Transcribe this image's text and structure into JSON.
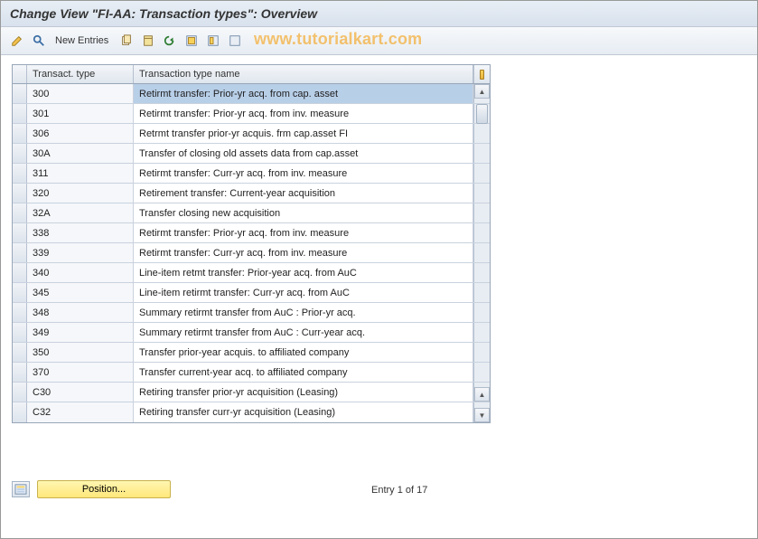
{
  "title": "Change View \"FI-AA: Transaction types\": Overview",
  "toolbar": {
    "new_entries": "New Entries"
  },
  "watermark": "www.tutorialkart.com",
  "table": {
    "headers": {
      "type": "Transact. type",
      "name": "Transaction type name"
    },
    "rows": [
      {
        "type": "300",
        "name": "Retirmt transfer: Prior-yr acq. from cap. asset",
        "highlight": true
      },
      {
        "type": "301",
        "name": "Retirmt transfer: Prior-yr acq. from inv. measure"
      },
      {
        "type": "306",
        "name": "Retrmt transfer prior-yr acquis. frm cap.asset  FI"
      },
      {
        "type": "30A",
        "name": "Transfer of closing old assets data from cap.asset"
      },
      {
        "type": "311",
        "name": "Retirmt transfer: Curr-yr acq. from inv. measure"
      },
      {
        "type": "320",
        "name": "Retirement transfer: Current-year acquisition"
      },
      {
        "type": "32A",
        "name": "Transfer closing new acquisition"
      },
      {
        "type": "338",
        "name": "Retirmt transfer: Prior-yr acq. from inv. measure"
      },
      {
        "type": "339",
        "name": "Retirmt transfer: Curr-yr acq. from inv. measure"
      },
      {
        "type": "340",
        "name": "Line-item retmt transfer: Prior-year acq. from AuC"
      },
      {
        "type": "345",
        "name": "Line-item retirmt transfer: Curr-yr acq. from AuC"
      },
      {
        "type": "348",
        "name": "Summary retirmt transfer from AuC : Prior-yr acq."
      },
      {
        "type": "349",
        "name": "Summary retirmt transfer from AuC : Curr-year acq."
      },
      {
        "type": "350",
        "name": "Transfer prior-year acquis. to affiliated company"
      },
      {
        "type": "370",
        "name": "Transfer current-year acq. to affiliated company"
      },
      {
        "type": "C30",
        "name": "Retiring transfer prior-yr acquisition (Leasing)"
      },
      {
        "type": "C32",
        "name": "Retiring transfer curr-yr acquisition (Leasing)"
      }
    ]
  },
  "footer": {
    "position_label": "Position...",
    "entry_status": "Entry 1 of 17"
  }
}
